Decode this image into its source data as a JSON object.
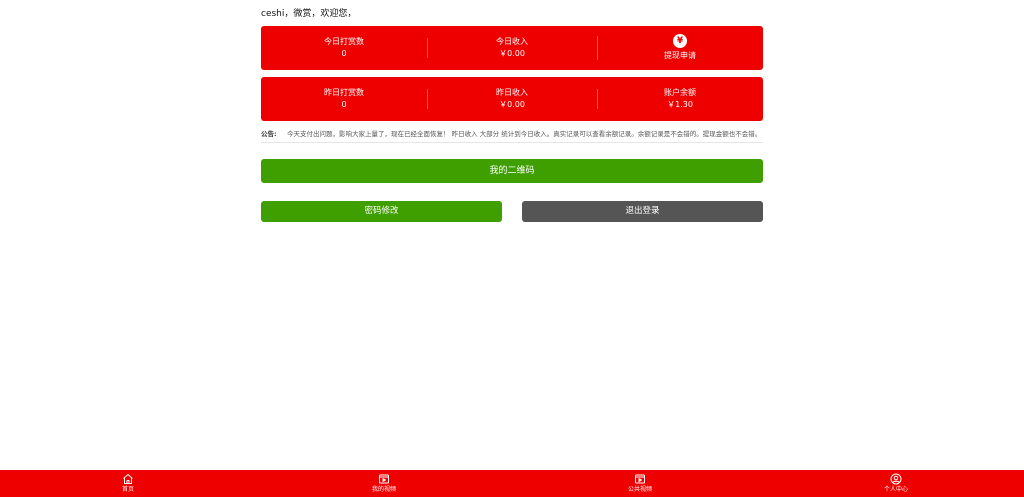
{
  "welcome": "ceshi，微赏，欢迎您，",
  "today": {
    "tips_label": "今日打赏数",
    "tips_value": "0",
    "income_label": "今日收入",
    "income_value": "￥0.00",
    "withdraw_icon": "¥",
    "withdraw_label": "提现申请"
  },
  "yesterday": {
    "tips_label": "昨日打赏数",
    "tips_value": "0",
    "income_label": "昨日收入",
    "income_value": "￥0.00",
    "balance_label": "账户余额",
    "balance_value": "￥1.30"
  },
  "notice": {
    "label": "公告:",
    "text": "今天支付出问题，影响大家上量了，现在已经全面恢复！ 昨日收入 大部分 统计到今日收入。真实记录可以查看余额记录。余额记录是不会错的。提现金额也不会错。"
  },
  "buttons": {
    "qrcode": "我的二维码",
    "change_password": "密码修改",
    "logout": "退出登录"
  },
  "nav": {
    "home": "首页",
    "my_videos": "我的视频",
    "public_videos": "公共视频",
    "profile": "个人中心"
  },
  "colors": {
    "primary_red": "#ee0000",
    "green": "#3f9f00",
    "gray": "#555555"
  },
  "icons": {
    "home": "home-icon",
    "my_videos": "video-icon",
    "public_videos": "video-icon",
    "profile": "user-icon"
  }
}
